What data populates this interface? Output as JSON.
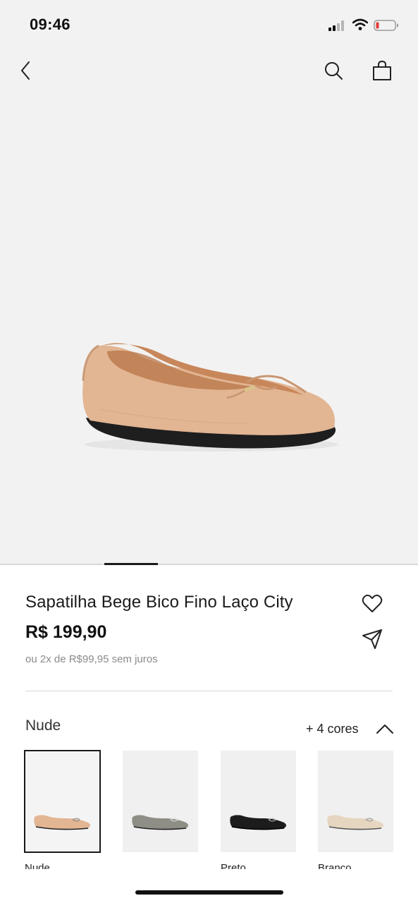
{
  "status_bar": {
    "time": "09:46",
    "battery_color": "#e53935"
  },
  "nav": {
    "back_icon": "chevron-left-icon",
    "search_icon": "search-icon",
    "bag_icon": "shopping-bag-icon"
  },
  "product": {
    "title": "Sapatilha Bege Bico Fino Laço City",
    "price": "R$ 199,90",
    "installments": "ou 2x de R$99,95 sem juros",
    "image_color": "#e4b595",
    "carousel": {
      "current": 2,
      "total": 6
    }
  },
  "actions": {
    "favorite_icon": "heart-icon",
    "share_icon": "send-icon"
  },
  "colors": {
    "selected_name": "Nude",
    "more_label": "+ 4 cores",
    "expanded": true,
    "options": [
      {
        "label": "Nude",
        "shoe_color": "#e2b593",
        "selected": true
      },
      {
        "label": "",
        "shoe_color": "#8f8e86",
        "selected": false
      },
      {
        "label": "Preto",
        "shoe_color": "#1c1c1c",
        "selected": false
      },
      {
        "label": "Branco",
        "shoe_color": "#e6d6c0",
        "selected": false
      }
    ]
  }
}
